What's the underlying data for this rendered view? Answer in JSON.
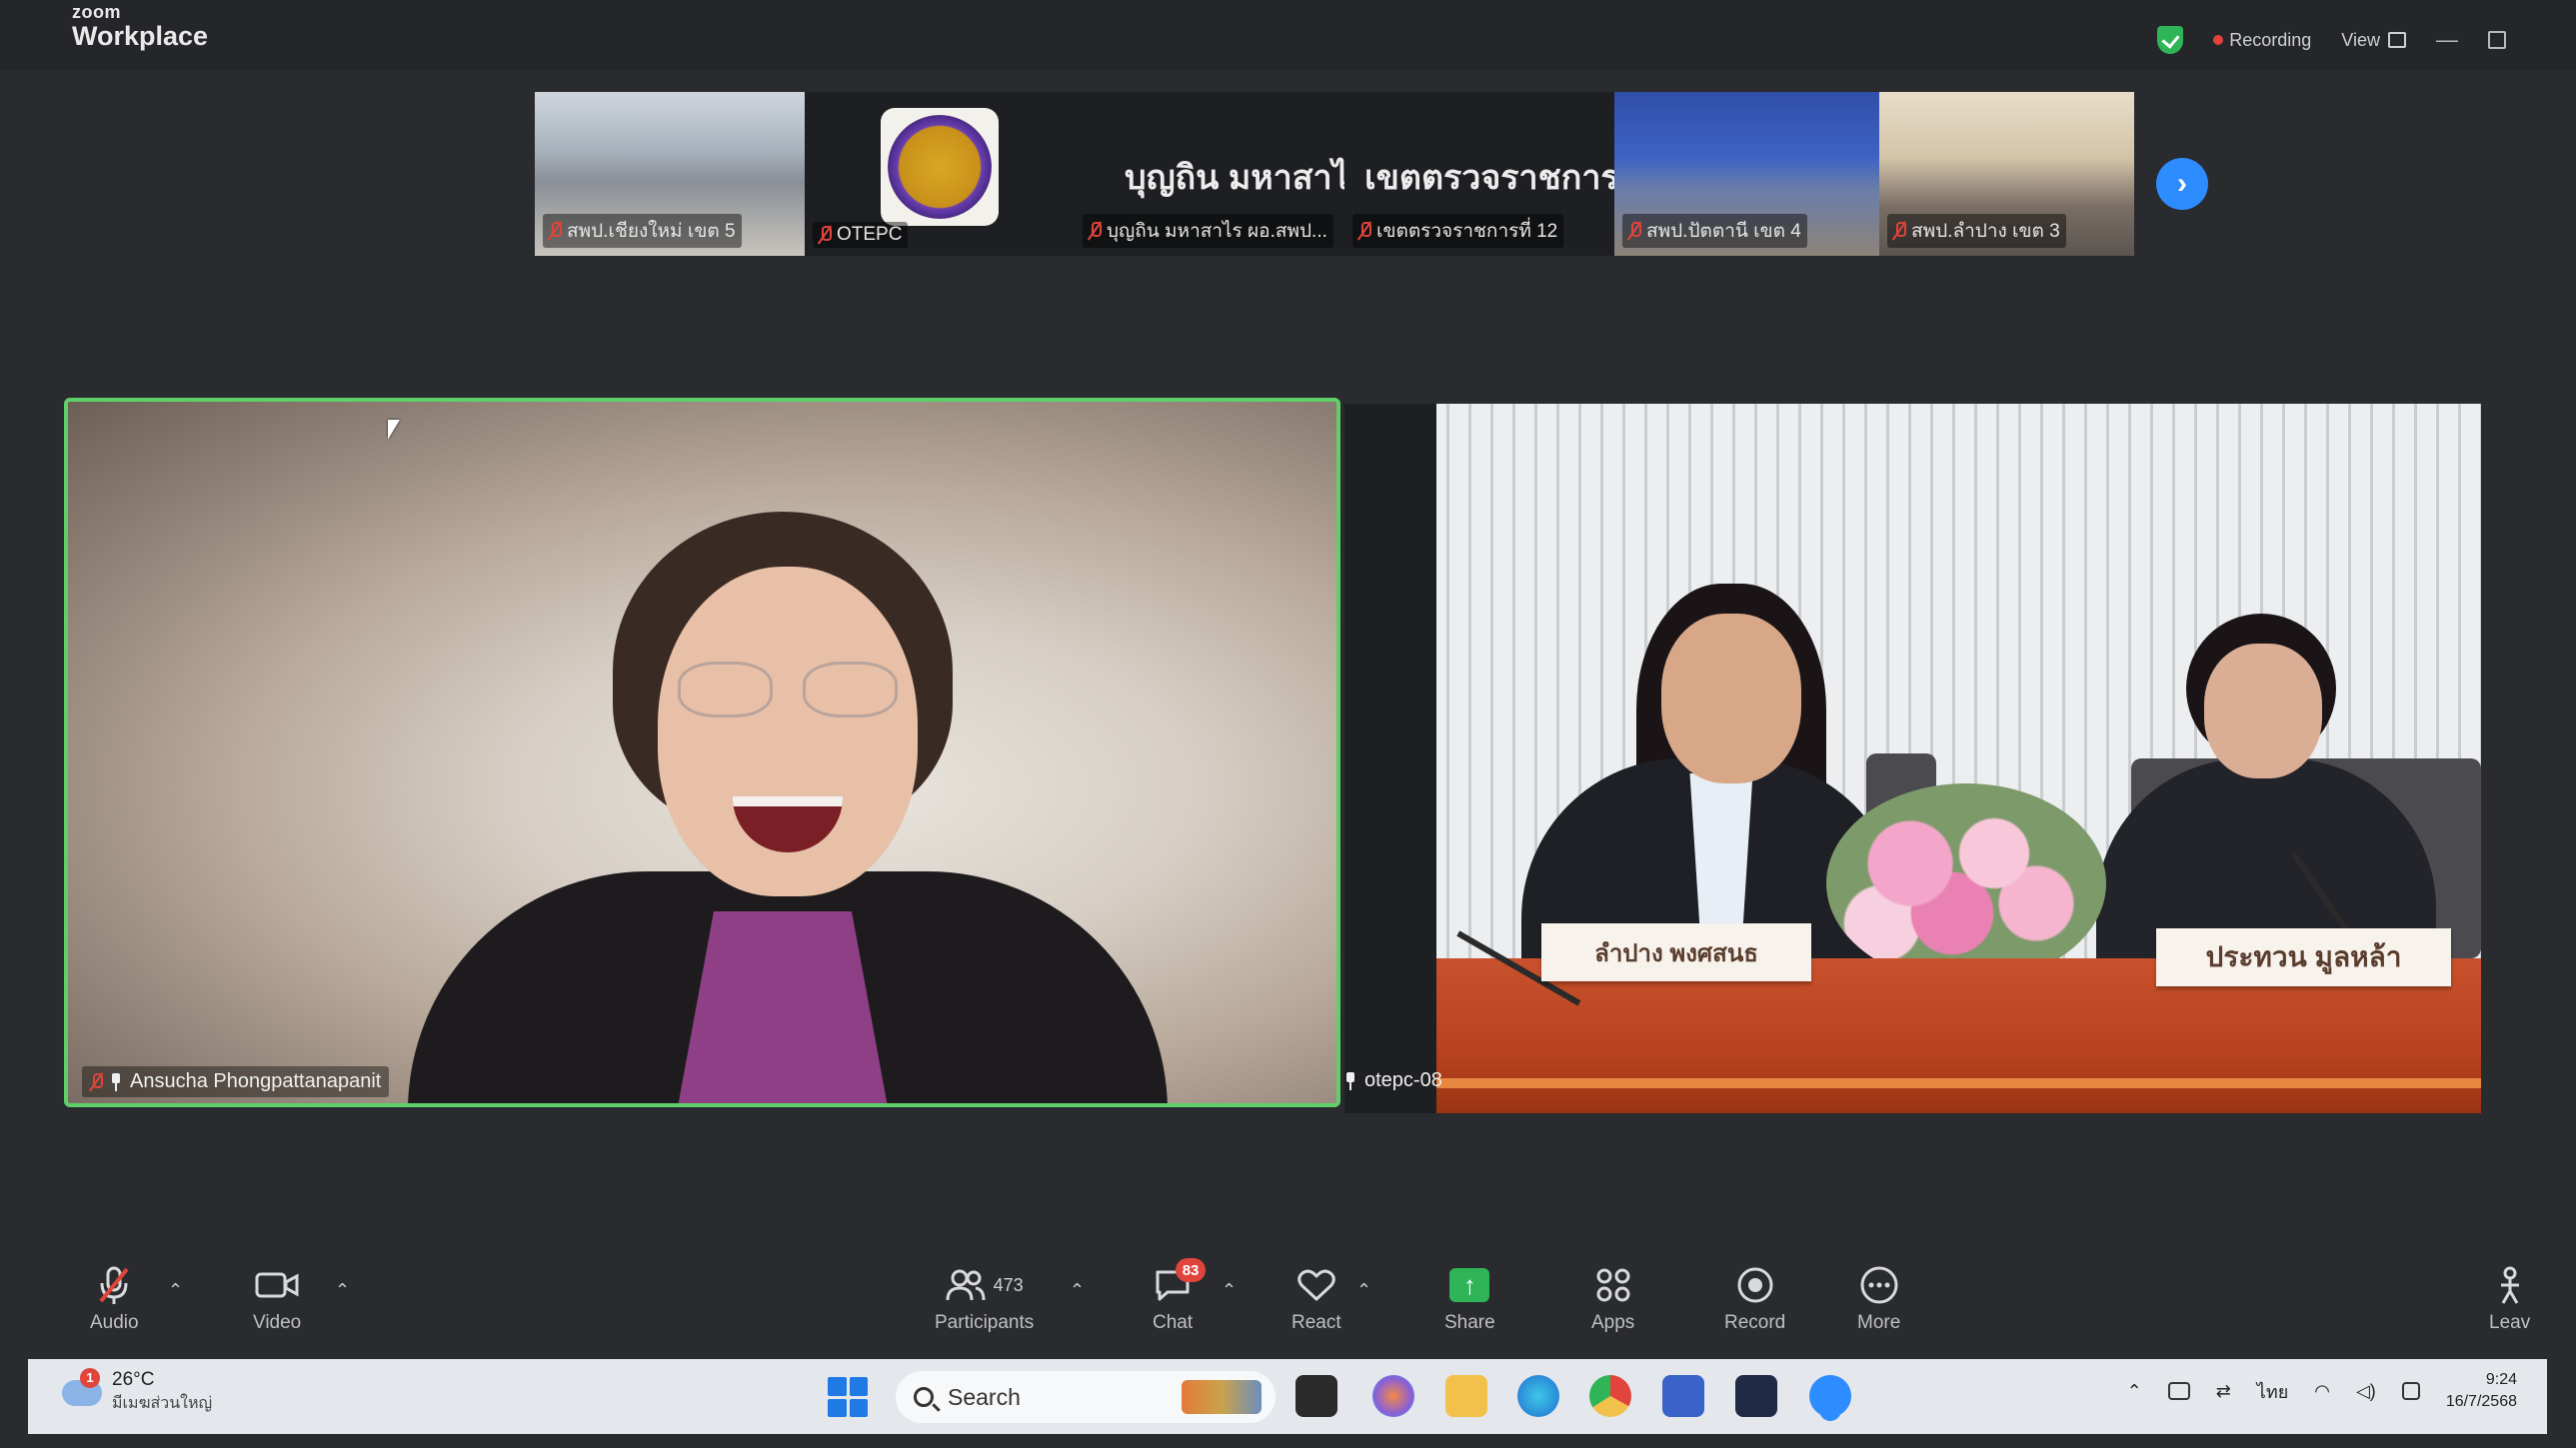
{
  "app": {
    "brand_small": "zoom",
    "brand_big": "Workplace"
  },
  "titlebar": {
    "recording": "Recording",
    "view": "View",
    "minimize": "—"
  },
  "gallery": {
    "tiles": [
      {
        "label": "สพป.เชียงใหม่ เขต 5"
      },
      {
        "label": "OTEPC"
      },
      {
        "title": "บุญถิน มหาสาไร...",
        "label": "บุญถิน มหาสาไร ผอ.สพป..."
      },
      {
        "title": "เขตตรวจราชการ...",
        "label": "เขตตรวจราชการที่ 12"
      },
      {
        "label": "สพป.ปัตตานี เขต 4"
      },
      {
        "label": "สพป.ลำปาง เขต 3"
      }
    ],
    "next": "›"
  },
  "videos": {
    "left_name": "Ansucha Phongpattanapanit",
    "right_name": "otepc-08",
    "nameplate_left": "ลำปาง พงศสนธ",
    "nameplate_right": "ประทวน มูลหล้า"
  },
  "toolbar": {
    "audio": "Audio",
    "video": "Video",
    "participants": "Participants",
    "participants_count": "473",
    "chat": "Chat",
    "chat_badge": "83",
    "react": "React",
    "share": "Share",
    "apps": "Apps",
    "record": "Record",
    "more": "More",
    "leave": "Leav"
  },
  "taskbar": {
    "weather_temp": "26°C",
    "weather_desc": "มีเมฆส่วนใหญ่",
    "weather_badge": "1",
    "search_placeholder": "Search",
    "lang": "ไทย",
    "time": "9:24",
    "date": "16/7/2568"
  },
  "colors": {
    "active_speaker": "#5fd068",
    "accent": "#2d8cff",
    "recording": "#e0443a",
    "share": "#2fb457"
  }
}
